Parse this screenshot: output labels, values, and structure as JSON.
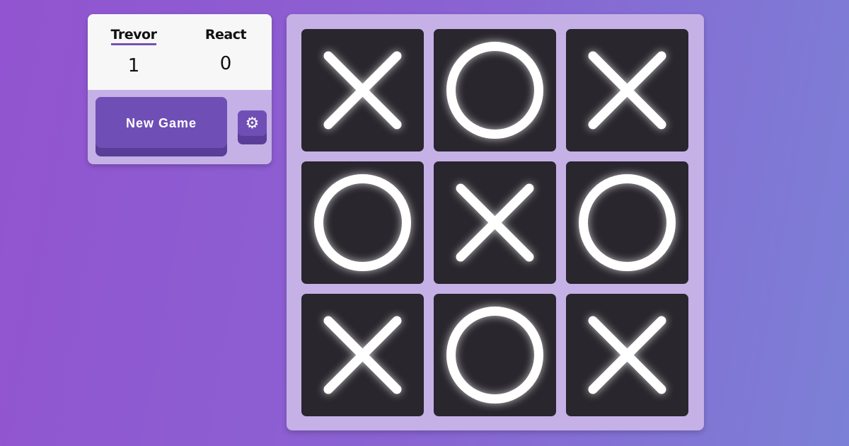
{
  "scoreboard": {
    "players": [
      {
        "name": "Trevor",
        "score": "1",
        "active": true
      },
      {
        "name": "React",
        "score": "0",
        "active": false
      }
    ]
  },
  "controls": {
    "new_game_label": "New Game",
    "settings_icon": "gear-icon"
  },
  "board": {
    "cells": [
      "X",
      "O",
      "X",
      "O",
      "X",
      "O",
      "X",
      "O",
      "X"
    ]
  },
  "colors": {
    "accent": "#6f4fb5",
    "board": "#c5b1e6",
    "cell": "#29262d",
    "mark": "#ffffff"
  }
}
